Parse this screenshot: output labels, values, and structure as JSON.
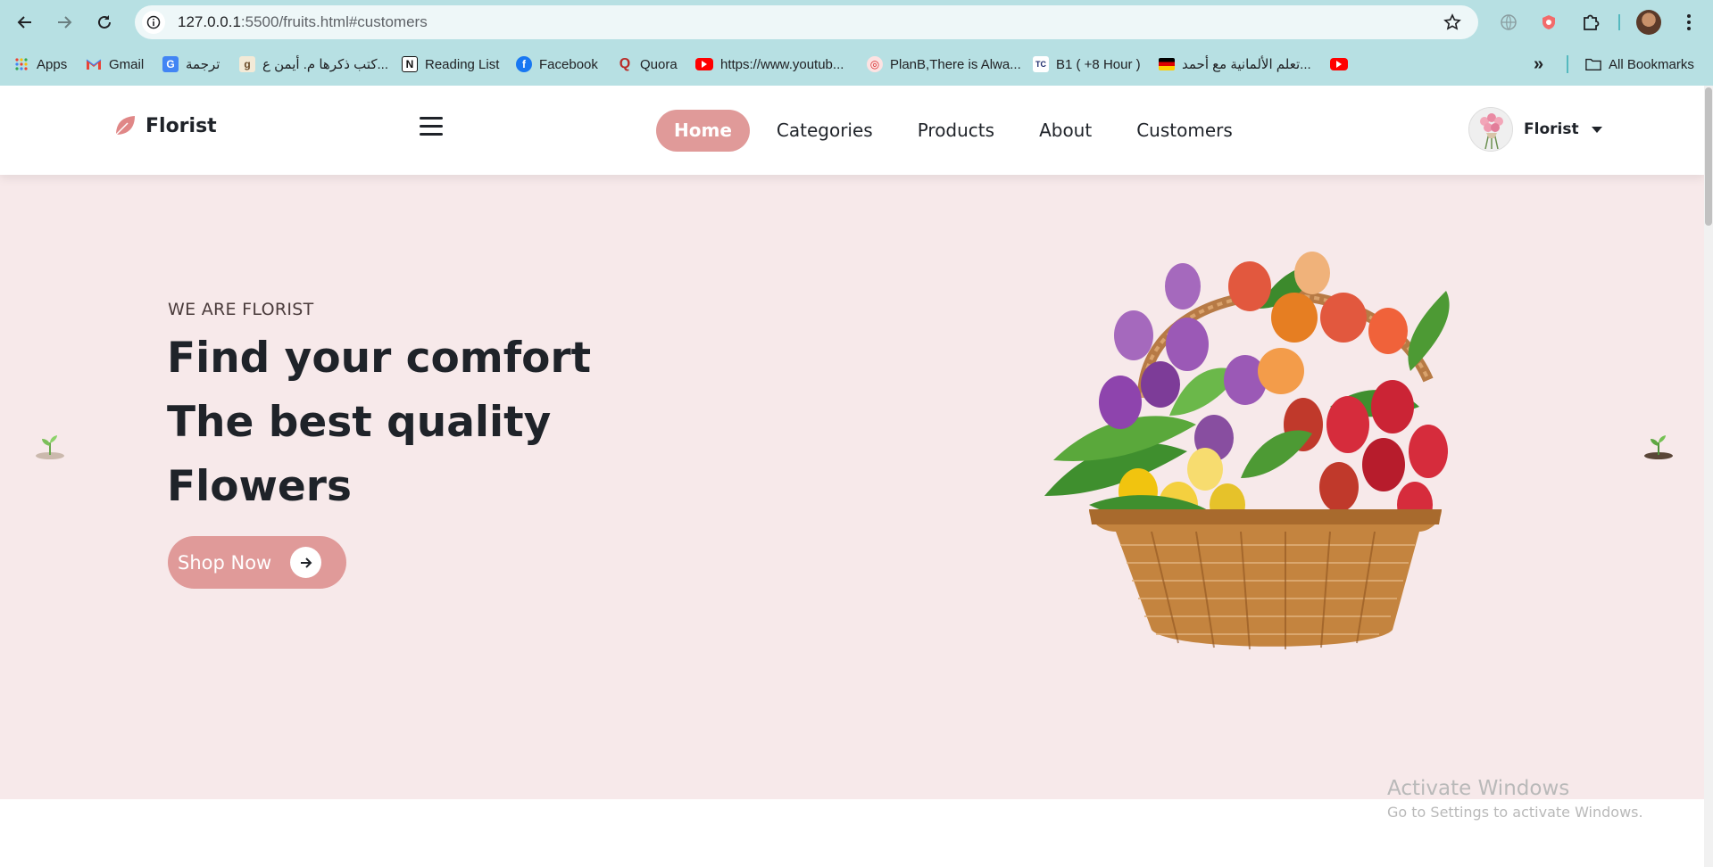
{
  "browser": {
    "url_host": "127.0.0.1",
    "url_rest": ":5500/fruits.html#customers",
    "bookmarks": [
      {
        "label": "Apps",
        "icon": "apps-grid-icon"
      },
      {
        "label": "Gmail",
        "icon": "gmail-icon"
      },
      {
        "label": "ترجمة",
        "icon": "translate-icon"
      },
      {
        "label": "كتب ذكرها م. أيمن ع...",
        "icon": "goodreads-icon"
      },
      {
        "label": "Reading List",
        "icon": "notion-icon"
      },
      {
        "label": "Facebook",
        "icon": "facebook-icon"
      },
      {
        "label": "Quora",
        "icon": "quora-icon"
      },
      {
        "label": "https://www.youtub...",
        "icon": "youtube-icon"
      },
      {
        "label": "PlanB,There is Alwa...",
        "icon": "podcast-icon"
      },
      {
        "label": "B1 ( +8 Hour )",
        "icon": "tc-icon"
      },
      {
        "label": "تعلم الألمانية مع أحمد...",
        "icon": "german-flag-icon"
      },
      {
        "label": "",
        "icon": "youtube-icon"
      }
    ],
    "more_bookmarks": "»",
    "all_bookmarks": "All Bookmarks"
  },
  "site": {
    "brand": "Florist",
    "nav": [
      "Home",
      "Categories",
      "Products",
      "About",
      "Customers"
    ],
    "active_nav": "Home",
    "user_name": "Florist"
  },
  "hero": {
    "subtitle": "WE ARE FLORIST",
    "title_lines": [
      "Find your comfort",
      "The best quality",
      "Flowers"
    ],
    "button_label": "Shop Now"
  },
  "watermark": {
    "title": "Activate Windows",
    "subtitle": "Go to Settings to activate Windows."
  },
  "colors": {
    "accent": "#e09a99",
    "hero_bg": "#f7e9ea",
    "chrome": "#b7e0e3",
    "text_dark": "#1f2329"
  }
}
